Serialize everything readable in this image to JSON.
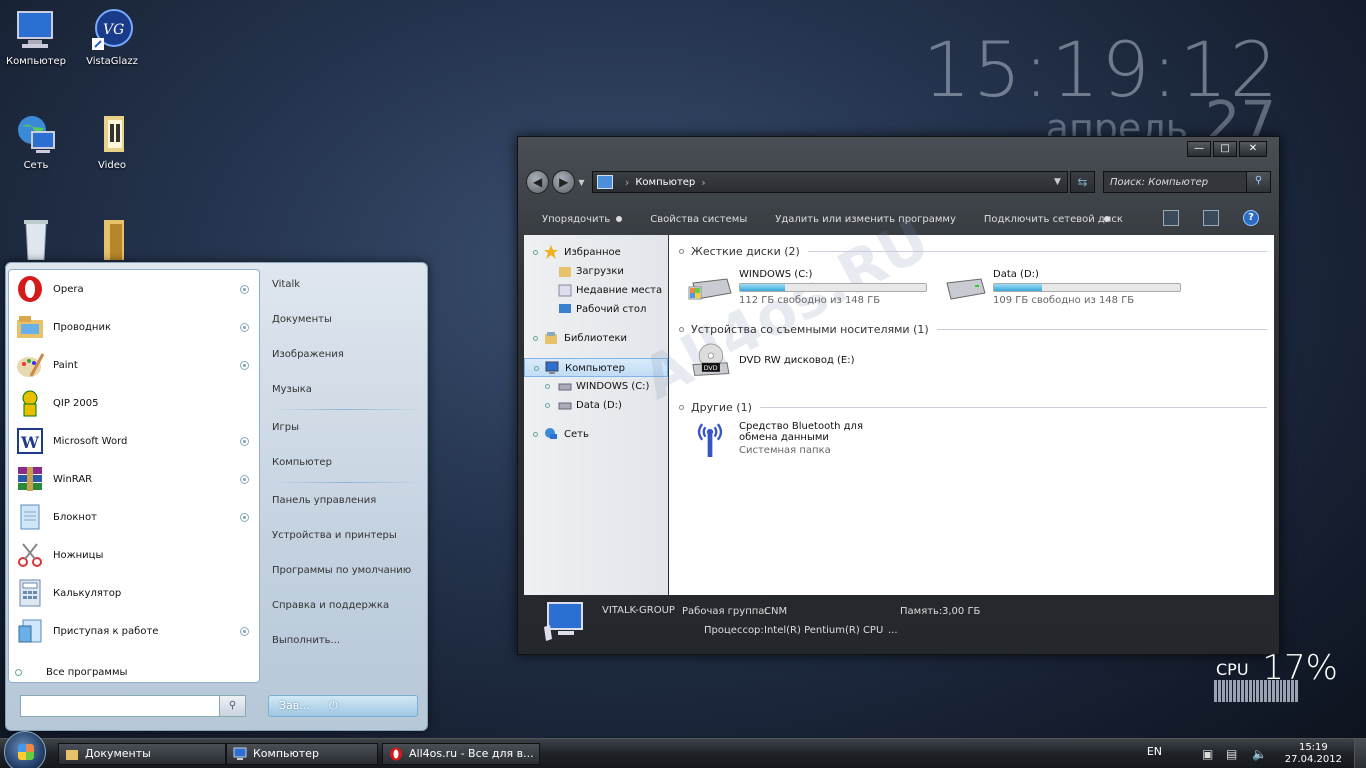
{
  "desktop": {
    "icons": [
      {
        "label": "Компьютер",
        "icon": "computer-icon"
      },
      {
        "label": "VistaGlazz",
        "icon": "vistaglazz-icon"
      },
      {
        "label": "Сеть",
        "icon": "network-icon"
      },
      {
        "label": "Video",
        "icon": "folder-icon"
      }
    ],
    "watermark": "All4os.RU"
  },
  "clock": {
    "time": "15:19:12",
    "month": "апрель",
    "day": "27"
  },
  "explorer": {
    "window_buttons": {
      "minimize": "—",
      "maximize": "□",
      "close": "✕"
    },
    "address": {
      "crumb": "Компьютер"
    },
    "search_placeholder": "Поиск: Компьютер",
    "toolbar": {
      "organize": "Упорядочить",
      "system_props": "Свойства системы",
      "uninstall": "Удалить или изменить программу",
      "map_drive": "Подключить сетевой диск"
    },
    "nav": {
      "favorites": "Избранное",
      "downloads": "Загрузки",
      "recent": "Недавние места",
      "desktop": "Рабочий стол",
      "libraries": "Библиотеки",
      "computer": "Компьютер",
      "drive_c": "WINDOWS (C:)",
      "drive_d": "Data (D:)",
      "network": "Сеть"
    },
    "groups": {
      "hdd": "Жесткие диски (2)",
      "removable": "Устройства со съемными носителями (1)",
      "other": "Другие (1)"
    },
    "drives": [
      {
        "name": "WINDOWS (C:)",
        "free": "112 ГБ свободно из 148 ГБ",
        "used_fraction": 0.24
      },
      {
        "name": "Data (D:)",
        "free": "109 ГБ свободно из 148 ГБ",
        "used_fraction": 0.26
      }
    ],
    "dvd": {
      "name": "DVD RW дисковод (E:)",
      "badge": "DVD"
    },
    "bluetooth": {
      "name": "Средство Bluetooth для обмена данными",
      "type": "Системная папка"
    },
    "details": {
      "name": "VITALK-GROUP",
      "workgroup_label": "Рабочая группа:",
      "workgroup": "CNM",
      "memory_label": "Память:",
      "memory": "3,00 ГБ",
      "cpu_label": "Процессор:",
      "cpu": "Intel(R) Pentium(R) CPU",
      "cpu_more": "..."
    }
  },
  "start_menu": {
    "programs": [
      {
        "label": "Opera",
        "icon": "opera-icon",
        "arrow": true
      },
      {
        "label": "Проводник",
        "icon": "explorer-icon",
        "arrow": true
      },
      {
        "label": "Paint",
        "icon": "paint-icon",
        "arrow": true
      },
      {
        "label": "QIP 2005",
        "icon": "qip-icon",
        "arrow": false
      },
      {
        "label": "Microsoft Word",
        "icon": "word-icon",
        "arrow": true
      },
      {
        "label": "WinRAR",
        "icon": "winrar-icon",
        "arrow": true
      },
      {
        "label": "Блокнот",
        "icon": "notepad-icon",
        "arrow": true
      },
      {
        "label": "Ножницы",
        "icon": "scissors-icon",
        "arrow": false
      },
      {
        "label": "Калькулятор",
        "icon": "calculator-icon",
        "arrow": false
      },
      {
        "label": "Приступая к работе",
        "icon": "getting-started-icon",
        "arrow": true
      }
    ],
    "all_programs": "Все программы",
    "right": {
      "user": "Vitalk",
      "documents": "Документы",
      "pictures": "Изображения",
      "music": "Музыка",
      "games": "Игры",
      "computer": "Компьютер",
      "control_panel": "Панель управления",
      "devices": "Устройства и принтеры",
      "defaults": "Программы по умолчанию",
      "help": "Справка и поддержка",
      "run": "Выполнить..."
    },
    "shutdown": "Зав..."
  },
  "cpu_gadget": {
    "label": "CPU",
    "value": "17%",
    "load_fraction": 0.17
  },
  "taskbar": {
    "tasks": [
      {
        "label": "Документы"
      },
      {
        "label": "Компьютер"
      },
      {
        "label": "All4os.ru - Все для в..."
      }
    ],
    "lang": "EN",
    "time": "15:19",
    "date": "27.04.2012"
  },
  "colors": {
    "accent": "#3aa8d8",
    "selection": "#c1dcf5"
  }
}
